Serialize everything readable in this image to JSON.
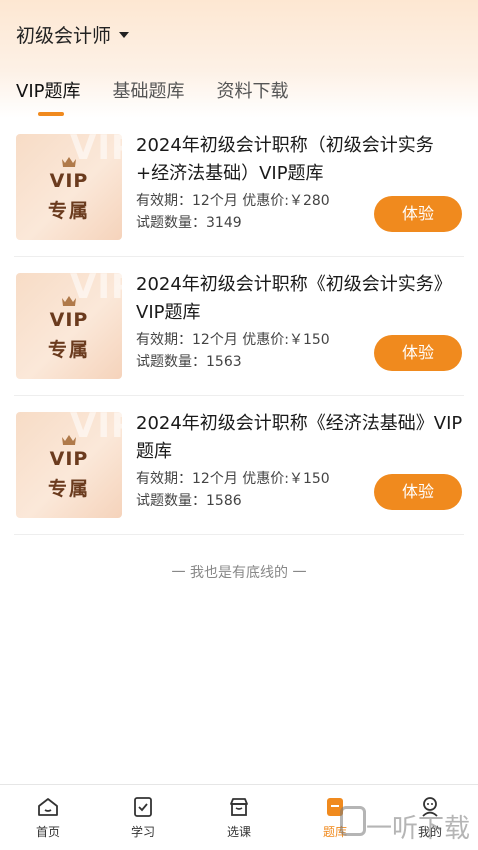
{
  "header": {
    "title": "初级会计师"
  },
  "tabs": [
    {
      "label": "VIP题库"
    },
    {
      "label": "基础题库"
    },
    {
      "label": "资料下载"
    }
  ],
  "products": [
    {
      "badge_line1": "VIP",
      "badge_line2": "专属",
      "watermark": "VIP",
      "title": "2024年初级会计职称（初级会计实务+经济法基础）VIP题库",
      "validity": "有效期：12个月 优惠价:￥280",
      "count": "试题数量：3149",
      "button": "体验"
    },
    {
      "badge_line1": "VIP",
      "badge_line2": "专属",
      "watermark": "VIP",
      "title": "2024年初级会计职称《初级会计实务》VIP题库",
      "validity": "有效期：12个月 优惠价:￥150",
      "count": "试题数量：1563",
      "button": "体验"
    },
    {
      "badge_line1": "VIP",
      "badge_line2": "专属",
      "watermark": "VIP",
      "title": "2024年初级会计职称《经济法基础》VIP题库",
      "validity": "有效期：12个月 优惠价:￥150",
      "count": "试题数量：1586",
      "button": "体验"
    }
  ],
  "footer_note": "一 我也是有底线的 一",
  "bottom_nav": [
    {
      "label": "首页",
      "icon": "home-icon"
    },
    {
      "label": "学习",
      "icon": "study-icon"
    },
    {
      "label": "选课",
      "icon": "store-icon"
    },
    {
      "label": "题库",
      "icon": "question-bank-icon"
    },
    {
      "label": "我的",
      "icon": "profile-icon"
    }
  ],
  "overlay_watermark": "一听下载",
  "colors": {
    "accent": "#f08a1e",
    "badge_text": "#6b3b1e",
    "header_gradient_top": "#fde7d2"
  }
}
